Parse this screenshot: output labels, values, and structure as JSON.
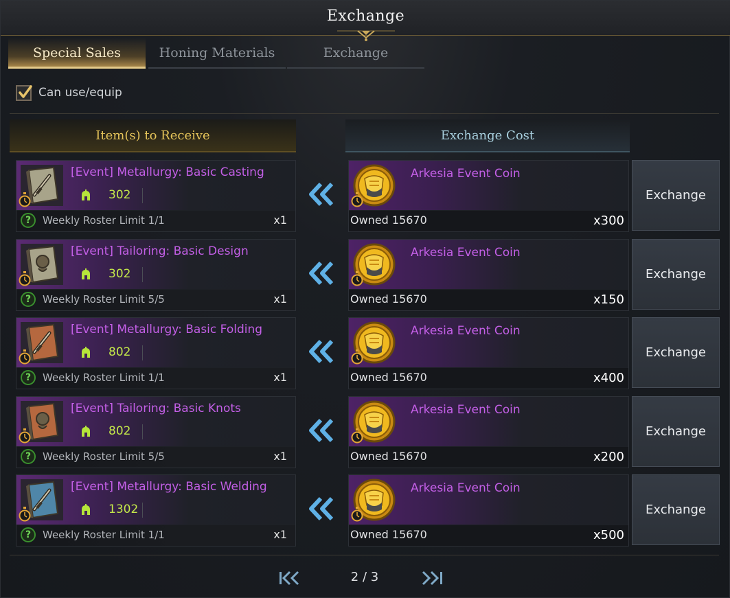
{
  "window": {
    "title": "Exchange"
  },
  "tabs": [
    {
      "label": "Special Sales",
      "active": true
    },
    {
      "label": "Honing Materials",
      "active": false
    },
    {
      "label": "Exchange",
      "active": false
    }
  ],
  "filter": {
    "label": "Can use/equip",
    "checked": true
  },
  "headers": {
    "receive": "Item(s) to Receive",
    "cost": "Exchange Cost"
  },
  "rows": [
    {
      "item_name": "[Event] Metallurgy: Basic Casting",
      "icon": "metallurgy-book-icon",
      "level": "302",
      "limit": "Weekly Roster Limit 1/1",
      "qty": "x1",
      "cost_item": "Arkesia Event Coin",
      "owned": "Owned 15670",
      "cost": "x300",
      "button": "Exchange"
    },
    {
      "item_name": "[Event] Tailoring: Basic Design",
      "icon": "tailoring-book-icon",
      "level": "302",
      "limit": "Weekly Roster Limit 5/5",
      "qty": "x1",
      "cost_item": "Arkesia Event Coin",
      "owned": "Owned 15670",
      "cost": "x150",
      "button": "Exchange"
    },
    {
      "item_name": "[Event] Metallurgy: Basic Folding",
      "icon": "metallurgy-book-icon",
      "level": "802",
      "limit": "Weekly Roster Limit 1/1",
      "qty": "x1",
      "cost_item": "Arkesia Event Coin",
      "owned": "Owned 15670",
      "cost": "x400",
      "button": "Exchange"
    },
    {
      "item_name": "[Event] Tailoring: Basic Knots",
      "icon": "tailoring-book-icon",
      "level": "802",
      "limit": "Weekly Roster Limit 5/5",
      "qty": "x1",
      "cost_item": "Arkesia Event Coin",
      "owned": "Owned 15670",
      "cost": "x200",
      "button": "Exchange"
    },
    {
      "item_name": "[Event] Metallurgy: Basic Welding",
      "icon": "metallurgy-book-icon",
      "level": "1302",
      "limit": "Weekly Roster Limit 1/1",
      "qty": "x1",
      "cost_item": "Arkesia Event Coin",
      "owned": "Owned 15670",
      "cost": "x500",
      "button": "Exchange"
    }
  ],
  "pagination": {
    "current": 2,
    "total": 3,
    "text": "2 / 3"
  },
  "colors": {
    "item_name": "#c35fe6",
    "level": "#c4e84a",
    "receive_header": "#e6c55a",
    "cost_header": "#a9d0df",
    "active_tab": "#e3c98a",
    "book_tones": [
      "#a8a48a",
      "#a8a48a",
      "#b5683f",
      "#b5683f",
      "#4f86a8"
    ]
  }
}
